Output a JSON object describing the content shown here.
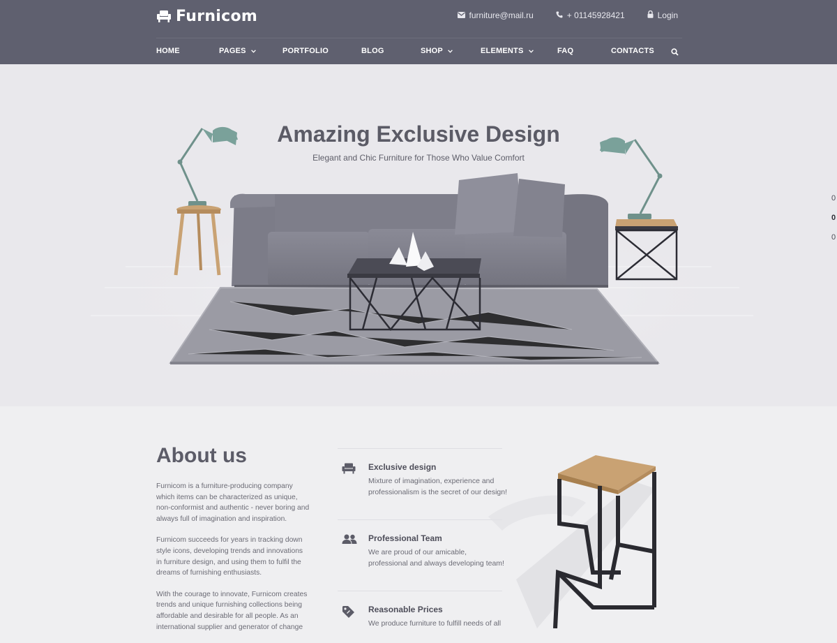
{
  "brand": {
    "name": "Furnicom",
    "logo_icon": "armchair-icon"
  },
  "top_bar": {
    "email": "furniture@mail.ru",
    "phone": "+ 01145928421",
    "login": "Login"
  },
  "nav": {
    "items": [
      {
        "label": "HOME",
        "has_dropdown": false
      },
      {
        "label": "PAGES",
        "has_dropdown": true
      },
      {
        "label": "PORTFOLIO",
        "has_dropdown": false
      },
      {
        "label": "BLOG",
        "has_dropdown": false
      },
      {
        "label": "SHOP",
        "has_dropdown": true
      },
      {
        "label": "ELEMENTS",
        "has_dropdown": true
      },
      {
        "label": "FAQ",
        "has_dropdown": false
      },
      {
        "label": "CONTACTS",
        "has_dropdown": false
      }
    ],
    "search_icon": "search-icon"
  },
  "hero": {
    "title": "Amazing Exclusive Design",
    "subtitle": "Elegant and Chic Furniture for Those Who Value Comfort",
    "slider_dots": [
      "0",
      "0",
      "0"
    ],
    "active_dot": 1
  },
  "about": {
    "title": "About us",
    "paragraphs": [
      "Furnicom is a furniture-producing company which items can be characterized as unique, non-conformist and authentic - never boring and always full of imagination and inspiration.",
      "Furnicom succeeds for years in tracking down style icons, developing trends and innovations in furniture design, and using them to fulfil the dreams of furnishing enthusiasts.",
      "With the courage to innovate, Furnicom creates trends and unique furnishing collections  being affordable and desirable for all people. As an international supplier and generator of change"
    ],
    "features": [
      {
        "icon": "armchair-icon",
        "title": "Exclusive design",
        "description": "Mixture of imagination, experience and professionalism is the secret of our design!"
      },
      {
        "icon": "team-icon",
        "title": "Professional Team",
        "description": "We are proud of our amicable, professional and always developing team!"
      },
      {
        "icon": "price-tag-icon",
        "title": "Reasonable Prices",
        "description": "We produce furniture to fulfill needs of all"
      }
    ]
  },
  "colors": {
    "header_bg": "#5f606f",
    "hero_bg": "#e9e8ec",
    "page_bg": "#efeff1",
    "text_dark": "#5c5c68",
    "lamp": "#6f918b",
    "wood": "#c9a273"
  }
}
